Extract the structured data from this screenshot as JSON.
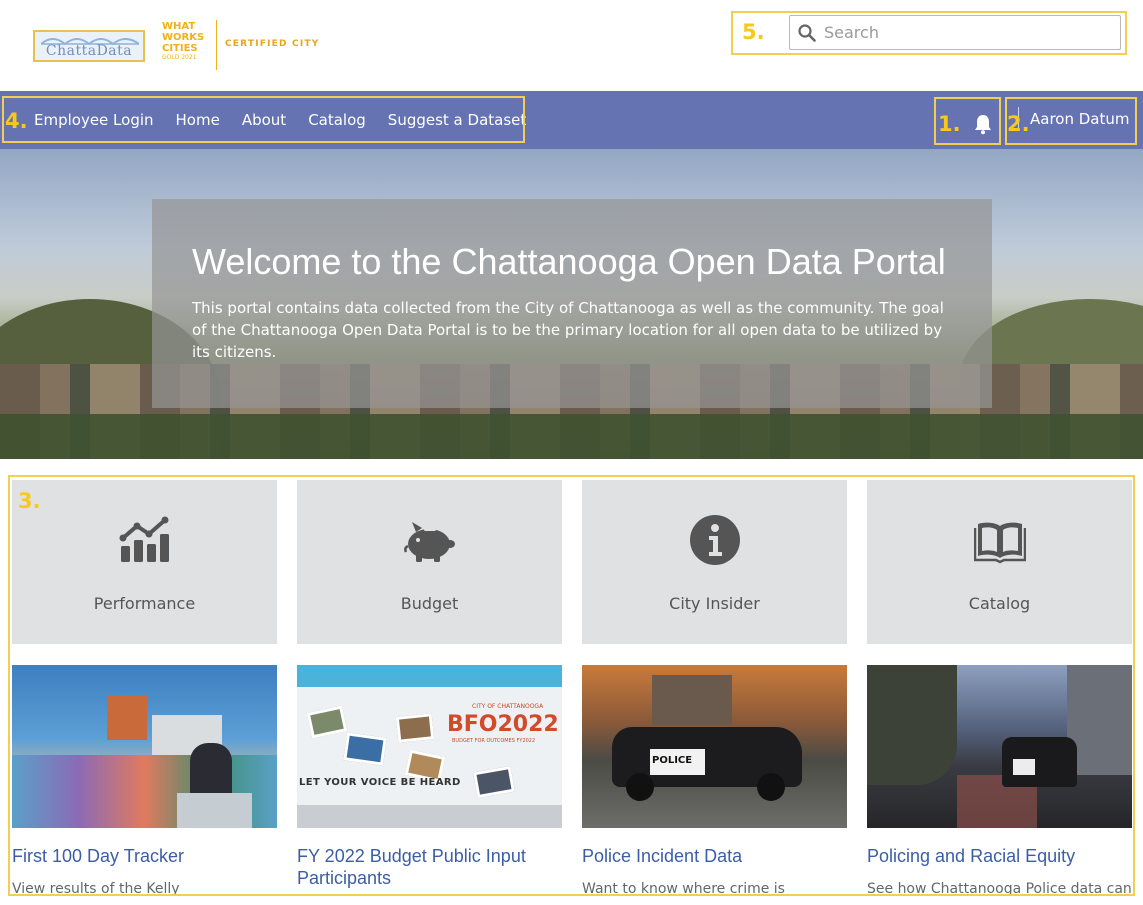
{
  "header": {
    "logo_text": "ChattaData",
    "wwc_logo": [
      "WHAT",
      "WORKS",
      "CITIES"
    ],
    "wwc_sub": "GOLD 2021",
    "certified_text": "CERTIFIED CITY",
    "search_placeholder": "Search"
  },
  "nav": {
    "links": [
      "Employee Login",
      "Home",
      "About",
      "Catalog",
      "Suggest a Dataset"
    ],
    "user_name": "Aaron Datum",
    "bell_icon": "bell-icon"
  },
  "annotations": [
    "1.",
    "2.",
    "3.",
    "4.",
    "5."
  ],
  "hero": {
    "title": "Welcome to the Chattanooga Open Data Portal",
    "text": "This portal contains data collected from the City of Chattanooga as well as the community. The goal of the Chattanooga Open Data Portal is to be the primary location for all open data to be utilized by its citizens."
  },
  "tiles": [
    {
      "label": "Performance",
      "icon": "performance-chart-icon"
    },
    {
      "label": "Budget",
      "icon": "piggy-bank-icon"
    },
    {
      "label": "City Insider",
      "icon": "info-icon"
    },
    {
      "label": "Catalog",
      "icon": "open-book-icon"
    }
  ],
  "cards": [
    {
      "title": "First 100 Day Tracker",
      "desc": "View results of the Kelly"
    },
    {
      "title": "FY 2022 Budget Public Input Participants",
      "desc": ""
    },
    {
      "title": "Police Incident Data",
      "desc": "Want to know where crime is"
    },
    {
      "title": "Policing and Racial Equity",
      "desc": "See how Chattanooga Police data can"
    }
  ],
  "card_images": {
    "bfo_small": "CITY OF CHATTANOOGA",
    "bfo_title": "BFO2022",
    "bfo_sub": "BUDGET FOR OUTCOMES FY2022",
    "bfo_banner": "LET YOUR VOICE BE HEARD",
    "police_text": "POLICE"
  },
  "colors": {
    "nav": "#6673b2",
    "annotation": "#f2cf50",
    "tile_bg": "#dfe1e2",
    "card_title": "#3b5ea6"
  }
}
